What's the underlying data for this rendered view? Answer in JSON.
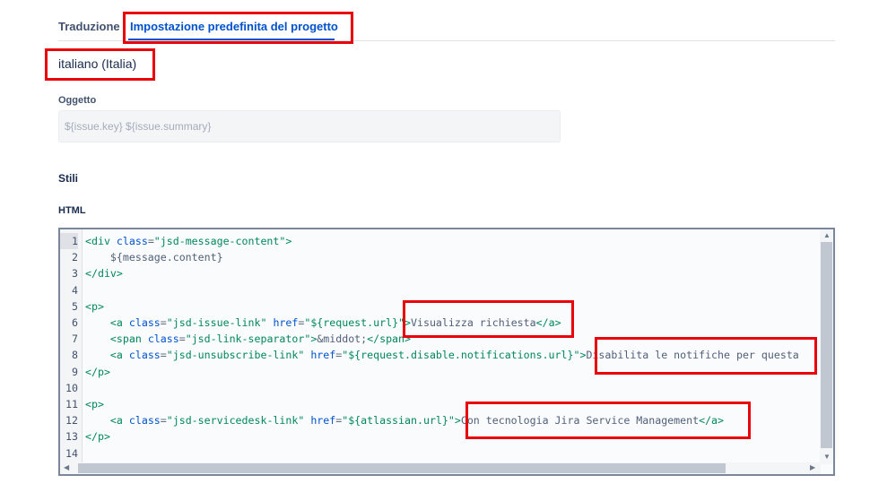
{
  "tabs": [
    {
      "label": "Traduzione"
    },
    {
      "label": "Impostazione predefinita del progetto"
    }
  ],
  "language": "italiano (Italia)",
  "subject": {
    "label": "Oggetto",
    "placeholder": "${issue.key} ${issue.summary}"
  },
  "styles_label": "Stili",
  "html_label": "HTML",
  "editor": {
    "line_numbers": [
      "1",
      "2",
      "3",
      "4",
      "5",
      "6",
      "7",
      "8",
      "9",
      "10",
      "11",
      "12",
      "13",
      "14"
    ],
    "lines": [
      "<div class=\"jsd-message-content\">",
      "    ${message.content}",
      "</div>",
      "",
      "<p>",
      "    <a class=\"jsd-issue-link\" href=\"${request.url}\">Visualizza richiesta</a>",
      "    <span class=\"jsd-link-separator\">&middot;</span>",
      "    <a class=\"jsd-unsubscribe-link\" href=\"${request.disable.notifications.url}\">Disabilita le notifiche per questa",
      "</p>",
      "",
      "<p>",
      "    <a class=\"jsd-servicedesk-link\" href=\"${atlassian.url}\">Con tecnologia Jira Service Management</a>",
      "</p>",
      ""
    ]
  },
  "colors": {
    "accent": "#0052cc",
    "highlight": "#e8000b",
    "tag": "#00875a"
  }
}
